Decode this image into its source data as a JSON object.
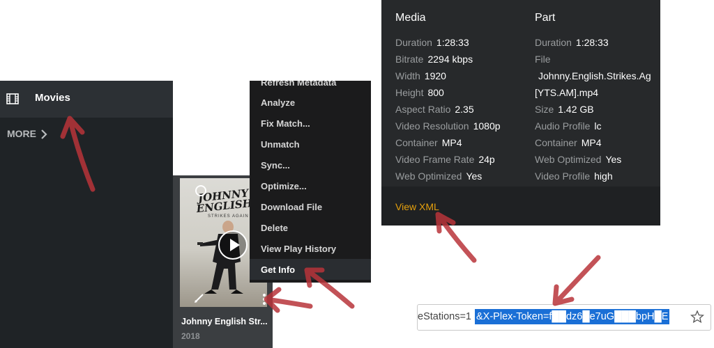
{
  "sidebar": {
    "movies_label": "Movies",
    "more_label": "MORE",
    "icons": {
      "library": "film-icon",
      "more": "chevron-right-icon"
    }
  },
  "poster": {
    "art_title": "JOHNNY ENGLISH",
    "art_subtitle": "STRIKES AGAIN",
    "card_title": "Johnny English Str...",
    "card_year": "2018"
  },
  "context_menu": {
    "items": [
      "Refresh Metadata",
      "Analyze",
      "Fix Match...",
      "Unmatch",
      "Sync...",
      "Optimize...",
      "Download File",
      "Delete",
      "View Play History",
      "Get Info"
    ],
    "highlighted": "Get Info"
  },
  "info_panel": {
    "media": {
      "heading": "Media",
      "rows": [
        {
          "label": "Duration",
          "value": "1:28:33"
        },
        {
          "label": "Bitrate",
          "value": "2294 kbps"
        },
        {
          "label": "Width",
          "value": "1920"
        },
        {
          "label": "Height",
          "value": "800"
        },
        {
          "label": "Aspect Ratio",
          "value": "2.35"
        },
        {
          "label": "Video Resolution",
          "value": "1080p"
        },
        {
          "label": "Container",
          "value": "MP4"
        },
        {
          "label": "Video Frame Rate",
          "value": "24p"
        },
        {
          "label": "Web Optimized",
          "value": "Yes"
        }
      ]
    },
    "part": {
      "heading": "Part",
      "duration": {
        "label": "Duration",
        "value": "1:28:33"
      },
      "file_label": "File",
      "file_line1": "Johnny.English.Strikes.Ag",
      "file_line2": "[YTS.AM].mp4",
      "rows": [
        {
          "label": "Size",
          "value": "1.42 GB"
        },
        {
          "label": "Audio Profile",
          "value": "lc"
        },
        {
          "label": "Container",
          "value": "MP4"
        },
        {
          "label": "Web Optimized",
          "value": "Yes"
        },
        {
          "label": "Video Profile",
          "value": "high"
        }
      ]
    },
    "view_xml": "View XML",
    "accent_color": "#e5a00d"
  },
  "address_bar": {
    "prefix": "eStations=1",
    "selected": "&X-Plex-Token=f██dz6█e7uG███bpH█E",
    "icons": {
      "bookmark": "star-icon"
    },
    "selection_color": "#1a6fd6"
  }
}
